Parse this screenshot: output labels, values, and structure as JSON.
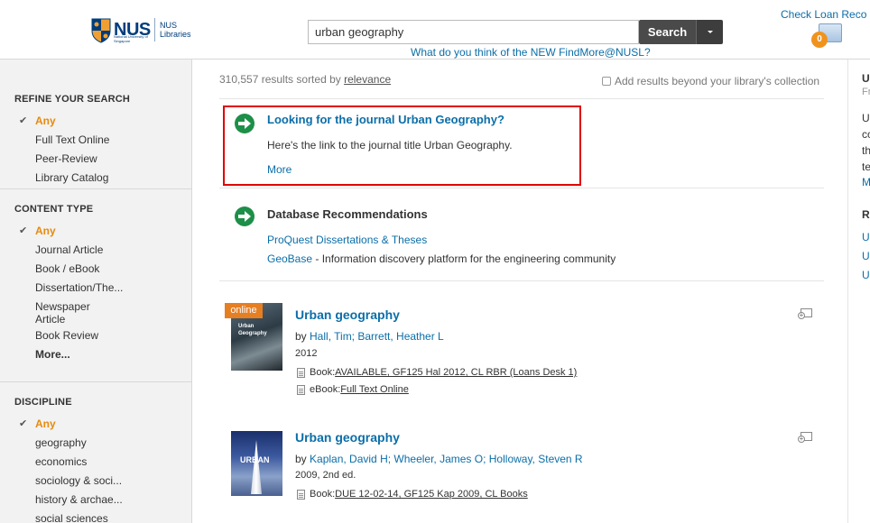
{
  "header": {
    "logo": {
      "word": "NUS",
      "sub": "National University of Singapore",
      "libraries_line1": "NUS",
      "libraries_line2": "Libraries"
    },
    "search": {
      "value": "urban geography",
      "button_label": "Search"
    },
    "feedback_link": "What do you think of the NEW FindMore@NUSL?",
    "check_loan": "Check Loan Reco",
    "basket_count": "0"
  },
  "sidebar": {
    "refine": {
      "title": "REFINE YOUR SEARCH",
      "items": [
        {
          "label": "Any",
          "selected": true
        },
        {
          "label": "Full Text Online"
        },
        {
          "label": "Peer-Review"
        },
        {
          "label": "Library Catalog"
        }
      ]
    },
    "content_type": {
      "title": "CONTENT TYPE",
      "items": [
        {
          "label": "Any",
          "selected": true
        },
        {
          "label": "Journal Article"
        },
        {
          "label": "Book / eBook"
        },
        {
          "label": "Dissertation/The..."
        },
        {
          "label": "Newspaper"
        },
        {
          "label": "Article"
        },
        {
          "label": "Book Review"
        }
      ],
      "more": "More..."
    },
    "discipline": {
      "title": "DISCIPLINE",
      "items": [
        {
          "label": "Any",
          "selected": true
        },
        {
          "label": "geography"
        },
        {
          "label": "economics"
        },
        {
          "label": "sociology & soci..."
        },
        {
          "label": "history & archae..."
        },
        {
          "label": "social sciences"
        }
      ]
    }
  },
  "main": {
    "results_count": "310,557 results sorted by",
    "sort_value": "relevance",
    "add_results_label": "Add results beyond your library's collection",
    "journal_rec": {
      "title": "Looking for the journal Urban Geography?",
      "text": "Here's the link to the journal title Urban Geography.",
      "more": "More"
    },
    "db_rec": {
      "title": "Database Recommendations",
      "link1": "ProQuest Dissertations & Theses",
      "link2": "GeoBase",
      "link2_desc": " - Information discovery platform for the engineering community"
    },
    "results": [
      {
        "badge": "online",
        "thumb_title": "Urban Geography",
        "title": "Urban geography",
        "by": "by ",
        "authors": "Hall, Tim; Barrett, Heather L",
        "year": "2012",
        "book_label": "Book: ",
        "book_value": "AVAILABLE, GF125 Hal 2012, CL RBR (Loans Desk 1)",
        "ebook_label": "eBook: ",
        "ebook_value": "Full Text Online"
      },
      {
        "thumb_title": "URBAN",
        "title": "Urban geography",
        "by": "by ",
        "authors": "Kaplan, David H; Wheeler, James O; Holloway, Steven R",
        "year": "2009, 2nd ed.",
        "book_label": "Book: ",
        "book_value": "DUE 12-02-14, GF125 Kap 2009, CL Books"
      }
    ]
  },
  "right_column": {
    "lines": [
      "U",
      "Fr",
      "U",
      "cc",
      "th",
      "te",
      "M",
      "R",
      "U",
      "U",
      "U"
    ]
  },
  "colors": {
    "accent_link": "#0b6ea8",
    "selected_facet": "#e68a0e",
    "highlight_border": "#e00000",
    "badge": "#e67e22"
  }
}
